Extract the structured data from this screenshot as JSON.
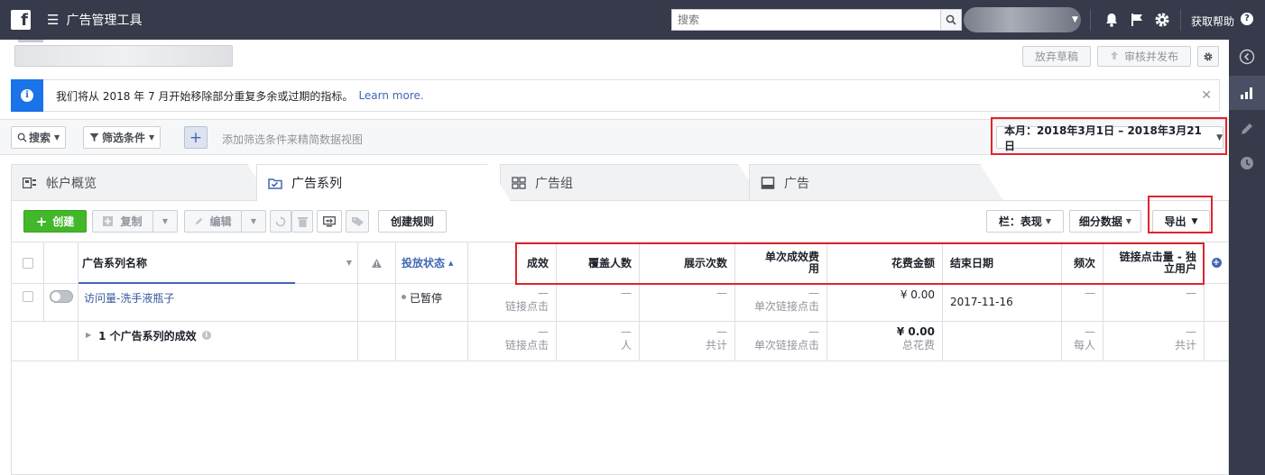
{
  "topbar": {
    "app_title": "广告管理工具",
    "search_placeholder": "搜索",
    "help_label": "获取帮助"
  },
  "header": {
    "discard_label": "放弃草稿",
    "review_publish_label": "审核并发布"
  },
  "notice": {
    "text": "我们将从 2018 年 7 月开始移除部分重复多余或过期的指标。",
    "link": "Learn more."
  },
  "filters": {
    "search_label": "搜索",
    "filter_label": "筛选条件",
    "hint": "添加筛选条件来精简数据视图",
    "date_range": "本月：2018年3月1日 – 2018年3月21日"
  },
  "tabs": [
    {
      "label": "帐户概览"
    },
    {
      "label": "广告系列"
    },
    {
      "label": "广告组"
    },
    {
      "label": "广告"
    }
  ],
  "toolbar": {
    "create_label": "创建",
    "copy_label": "复制",
    "edit_label": "编辑",
    "create_rule_label": "创建规则",
    "columns_label": "栏：表现",
    "breakdown_label": "细分数据",
    "export_label": "导出"
  },
  "table": {
    "headers": {
      "name": "广告系列名称",
      "status": "投放状态",
      "results": "成效",
      "reach": "覆盖人数",
      "impressions": "展示次数",
      "cost_per_result_1": "单次成效费",
      "cost_per_result_2": "用",
      "spend": "花费金额",
      "end_date": "结束日期",
      "frequency": "频次",
      "link_clicks_1": "链接点击量 - 独",
      "link_clicks_2": "立用户"
    },
    "row": {
      "name": "访问量-洗手液瓶子",
      "status": "已暂停",
      "results_dash": "—",
      "results_sub": "链接点击",
      "reach": "—",
      "impressions": "—",
      "cpr_dash": "—",
      "cpr_sub": "单次链接点击",
      "spend": "¥ 0.00",
      "end_date": "2017-11-16",
      "frequency": "—",
      "link_clicks": "—"
    },
    "summary": {
      "label": "1 个广告系列的成效",
      "results_dash": "—",
      "results_sub": "链接点击",
      "reach_dash": "—",
      "reach_sub": "人",
      "impr_dash": "—",
      "impr_sub": "共计",
      "cpr_dash": "—",
      "cpr_sub": "单次链接点击",
      "spend": "¥ 0.00",
      "spend_sub": "总花费",
      "freq_dash": "—",
      "freq_sub": "每人",
      "link_dash": "—",
      "link_sub": "共计"
    }
  }
}
